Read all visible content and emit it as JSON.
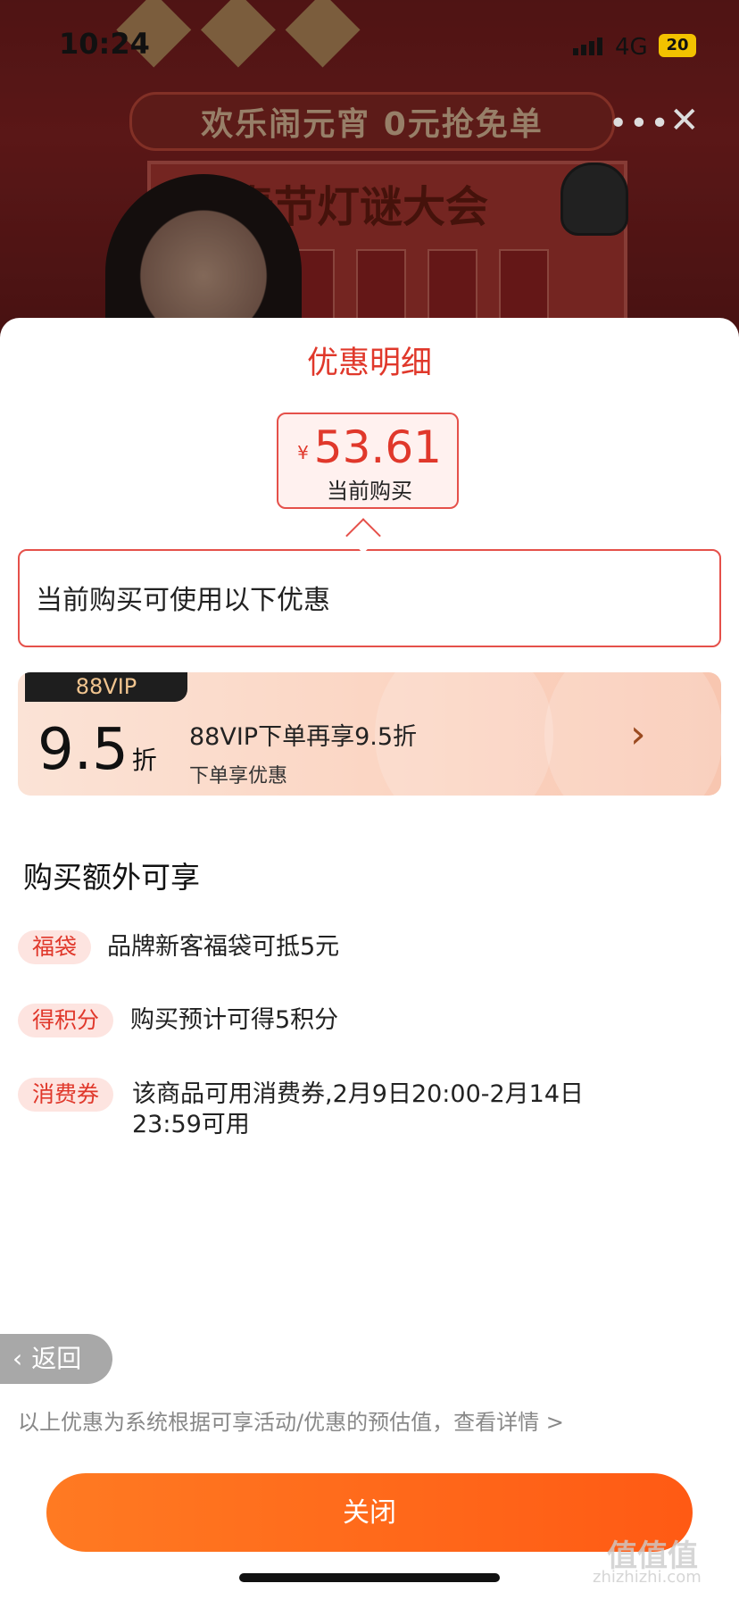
{
  "status_bar": {
    "time": "10:24",
    "network": "4G",
    "battery": "20"
  },
  "banner": {
    "promo_text": "欢乐闹元宵 0元抢免单",
    "board_title": "春节灯谜大会"
  },
  "capsule": {
    "more": "•••",
    "close": "✕"
  },
  "sheet": {
    "title": "优惠明细",
    "price": {
      "currency": "¥",
      "value": "53.61",
      "caption": "当前购买"
    },
    "info_text": "当前购买可使用以下优惠",
    "vip": {
      "tag": "88VIP",
      "discount": "9.5",
      "discount_unit": "折",
      "title": "88VIP下单再享9.5折",
      "subtitle": "下单享优惠",
      "chevron": "›"
    },
    "extra_heading": "购买额外可享",
    "perks": [
      {
        "tag": "福袋",
        "text": "品牌新客福袋可抵5元"
      },
      {
        "tag": "得积分",
        "text": "购买预计可得5积分"
      },
      {
        "tag": "消费券",
        "text": "该商品可用消费券,2月9日20:00-2月14日23:59可用"
      }
    ],
    "back_label": "返回",
    "disclaimer": "以上优惠为系统根据可享活动/优惠的预估值，查看详情 >",
    "close_label": "关闭"
  },
  "watermark": {
    "main": "值值值",
    "sub": "zhizhizhi.com"
  },
  "colors": {
    "accent": "#e0382b",
    "button": "#ff6a1a",
    "tag_bg": "#fde4e0"
  }
}
